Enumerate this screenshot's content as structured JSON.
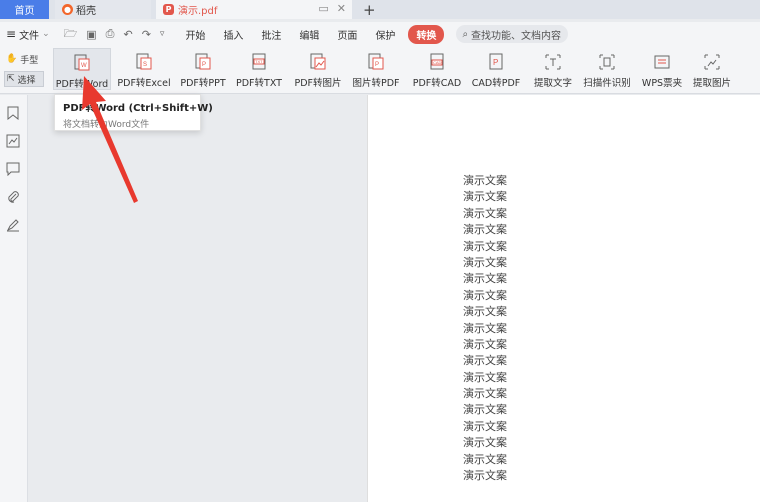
{
  "tabs": {
    "home": "首页",
    "daoke": "稻壳",
    "pdf": "演示.pdf"
  },
  "menubar": {
    "file": "文件",
    "items": [
      "开始",
      "插入",
      "批注",
      "编辑",
      "页面",
      "保护",
      "转换"
    ],
    "active": "转换",
    "search_placeholder": "查找功能、文档内容"
  },
  "side_tools": {
    "hand": "手型",
    "select": "选择"
  },
  "ribbon": {
    "buttons": [
      "PDF转Word",
      "PDF转Excel",
      "PDF转PPT",
      "PDF转TXT",
      "PDF转图片",
      "图片转PDF",
      "PDF转CAD",
      "CAD转PDF",
      "提取文字",
      "扫描件识别",
      "WPS票夹",
      "提取图片"
    ],
    "hovered": "PDF转Word"
  },
  "tooltip": {
    "title": "PDF转Word (Ctrl+Shift+W)",
    "desc": "将文档转为Word文件"
  },
  "document": {
    "lines": [
      "演示文案",
      "演示文案",
      "演示文案",
      "演示文案",
      "演示文案",
      "演示文案",
      "演示文案",
      "演示文案",
      "演示文案",
      "演示文案",
      "演示文案",
      "演示文案",
      "演示文案",
      "演示文案",
      "演示文案",
      "演示文案",
      "演示文案",
      "演示文案",
      "演示文案"
    ]
  },
  "colors": {
    "accent": "#e2574c",
    "home_tab": "#4a7de8",
    "arrow": "#e8392e"
  }
}
